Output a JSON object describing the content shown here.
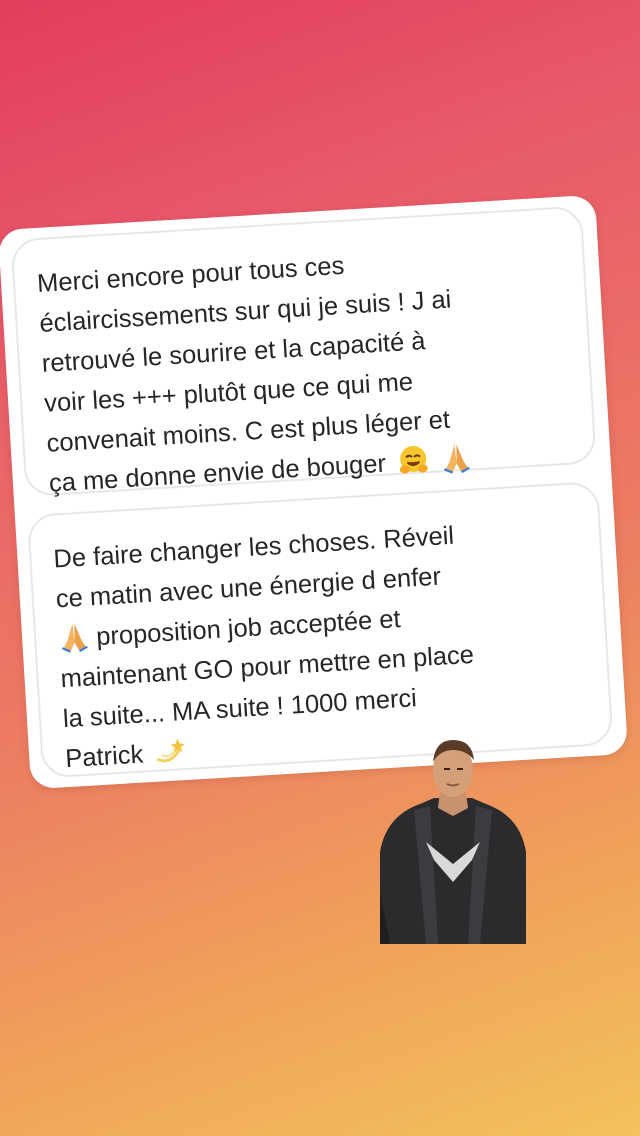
{
  "story": {
    "messages": [
      {
        "lines": [
          "Merci encore pour tous ces",
          "éclaircissements sur qui je suis ! J ai",
          "retrouvé le sourire et la capacité à",
          "voir les +++ plutôt que ce qui me",
          "convenait moins. C est plus léger et",
          "ça me donne envie de bouger"
        ],
        "trailing_emojis": [
          "hugging-face-emoji",
          "folded-hands-emoji"
        ]
      },
      {
        "lines": [
          "De faire changer les choses. Réveil",
          "ce matin avec une énergie d enfer",
          "proposition job acceptée et",
          "maintenant GO pour mettre en place",
          "la suite... MA suite ! 1000 merci",
          "Patrick"
        ],
        "inline_emojis": [
          "folded-hands-emoji",
          "dizzy-emoji"
        ]
      }
    ],
    "sticker": "person-sticker"
  }
}
